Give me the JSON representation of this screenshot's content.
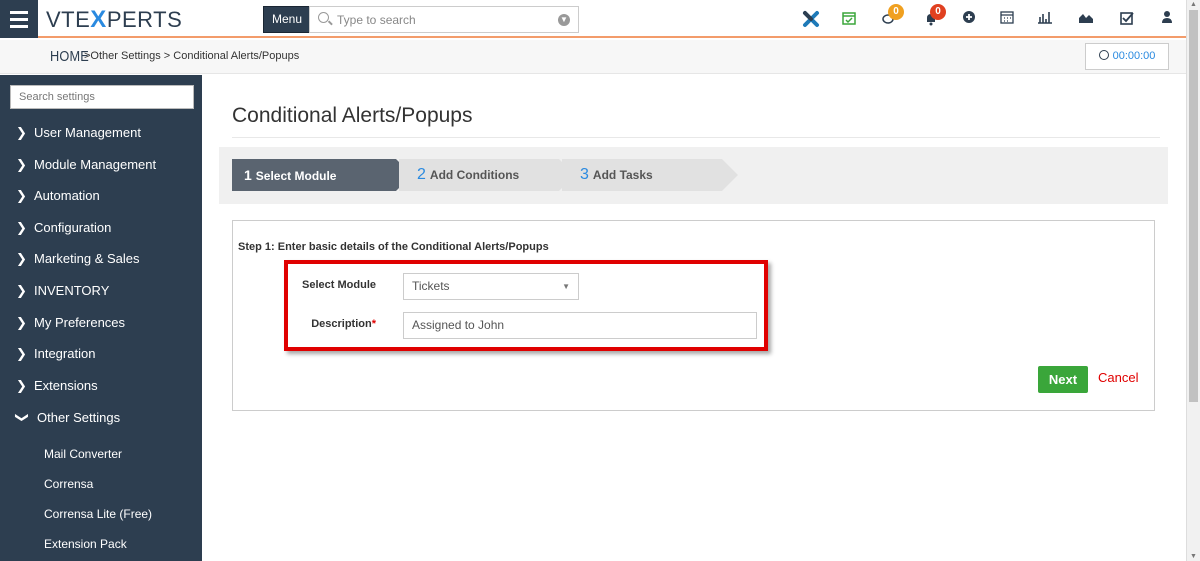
{
  "header": {
    "logo_left": "VTE",
    "logo_x": "X",
    "logo_right": "PERTS",
    "menu_label": "Menu",
    "search_placeholder": "Type to search",
    "icons": [
      "vtiger-x-icon",
      "calendar-check-icon",
      "chat-icon",
      "bell-icon",
      "plus-circle-icon",
      "calendar-icon",
      "bar-chart-icon",
      "area-chart-icon",
      "checkbox-icon",
      "user-icon"
    ],
    "chat_badge": "0",
    "bell_badge": "0",
    "colors": {
      "navy": "#2d3e50",
      "accent": "#f39c6b",
      "blue": "#2a8ae0",
      "badge_orange": "#f0a020",
      "badge_red": "#e04020"
    }
  },
  "breadcrumb": {
    "home": "HOME",
    "path": ">Other Settings > Conditional Alerts/Popups",
    "timer": "00:00:00"
  },
  "sidebar": {
    "search_placeholder": "Search settings",
    "items": [
      {
        "label": "User Management",
        "expanded": false
      },
      {
        "label": "Module Management",
        "expanded": false
      },
      {
        "label": "Automation",
        "expanded": false
      },
      {
        "label": "Configuration",
        "expanded": false
      },
      {
        "label": "Marketing & Sales",
        "expanded": false
      },
      {
        "label": "INVENTORY",
        "expanded": false
      },
      {
        "label": "My Preferences",
        "expanded": false
      },
      {
        "label": "Integration",
        "expanded": false
      },
      {
        "label": "Extensions",
        "expanded": false
      },
      {
        "label": "Other Settings",
        "expanded": true
      }
    ],
    "subitems": [
      "Mail Converter",
      "Corrensa",
      "Corrensa Lite (Free)",
      "Extension Pack"
    ]
  },
  "main": {
    "title": "Conditional Alerts/Popups",
    "steps": [
      {
        "num": "1",
        "label": "Select Module",
        "active": true
      },
      {
        "num": "2",
        "label": "Add Conditions",
        "active": false
      },
      {
        "num": "3",
        "label": "Add Tasks",
        "active": false
      }
    ],
    "step_heading": "Step 1: Enter basic details of the Conditional Alerts/Popups",
    "form": {
      "module_label": "Select Module",
      "module_value": "Tickets",
      "description_label": "Description",
      "required_mark": "*",
      "description_value": "Assigned to John"
    },
    "next_label": "Next",
    "cancel_label": "Cancel"
  }
}
